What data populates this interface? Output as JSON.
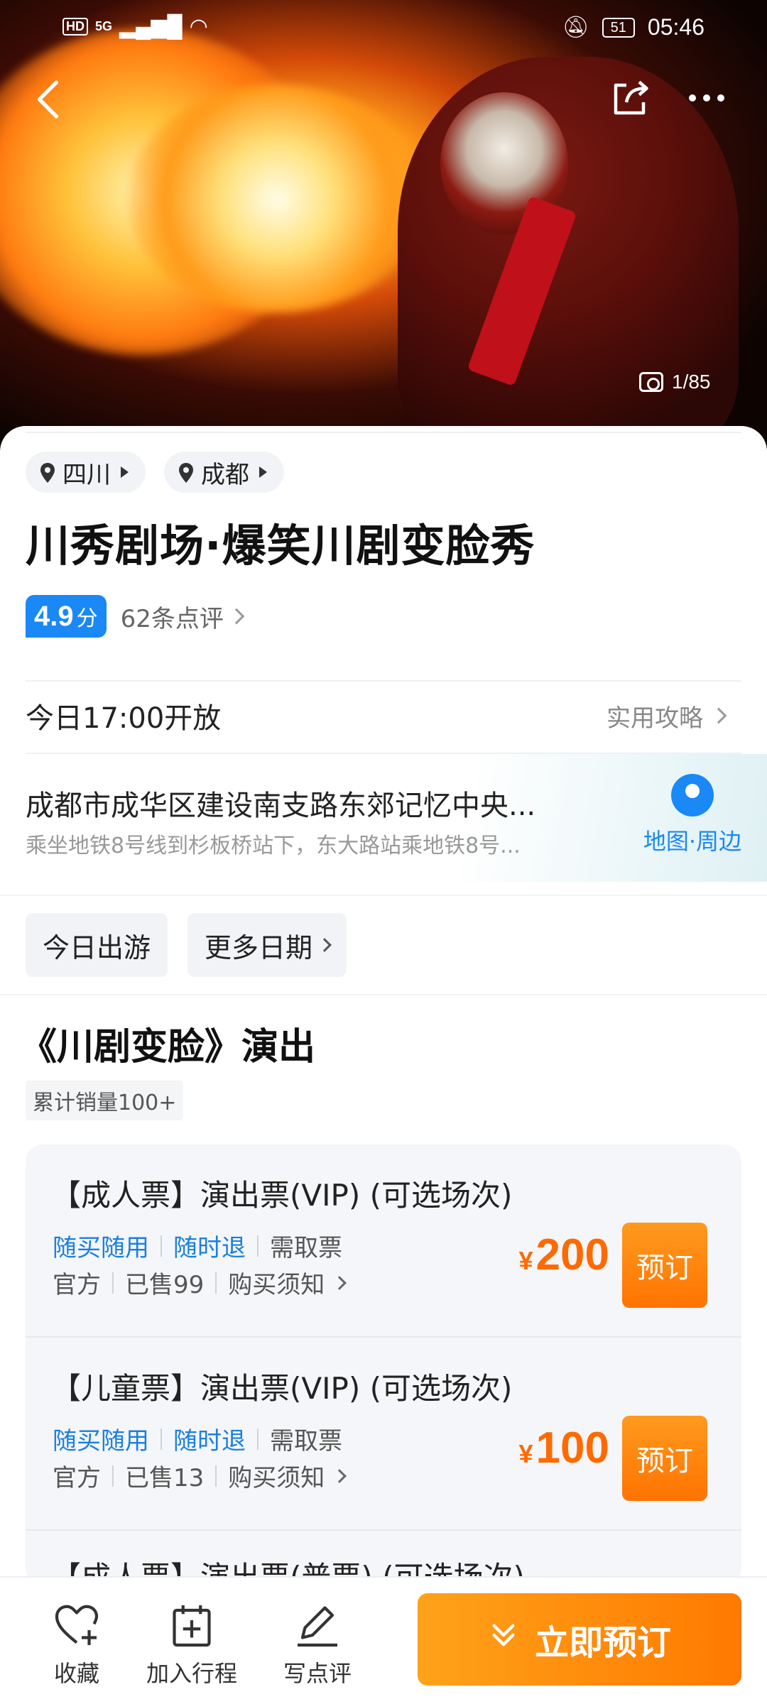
{
  "status": {
    "net_label": "HD",
    "signal": "5G",
    "battery": "51",
    "time": "05:46"
  },
  "hero": {
    "photo_counter": "1/85"
  },
  "location": {
    "province": "四川",
    "city": "成都"
  },
  "attraction": {
    "title": "川秀剧场·爆笑川剧变脸秀",
    "score": "4.9",
    "score_unit": "分",
    "reviews": "62条点评",
    "open_time": "今日17:00开放",
    "guide": "实用攻略",
    "address": "成都市成华区建设南支路东郊记忆中央...",
    "transit": "乘坐地铁8号线到杉板桥站下，东大路站乘地铁8号...",
    "map_label": "地图·周边"
  },
  "dates": {
    "today": "今日出游",
    "more": "更多日期"
  },
  "show": {
    "title": "《川剧变脸》演出",
    "sales": "累计销量100+",
    "tickets": [
      {
        "name": "【成人票】演出票(VIP) (可选场次)",
        "tag1": "随买随用",
        "tag2": "随时退",
        "tag3": "需取票",
        "source": "官方",
        "sold": "已售99",
        "notice": "购买须知",
        "currency": "¥",
        "price": "200",
        "book": "预订"
      },
      {
        "name": "【儿童票】演出票(VIP) (可选场次)",
        "tag1": "随买随用",
        "tag2": "随时退",
        "tag3": "需取票",
        "source": "官方",
        "sold": "已售13",
        "notice": "购买须知",
        "currency": "¥",
        "price": "100",
        "book": "预订"
      },
      {
        "name": "【成人票】演出票(普票) (可选场次)"
      }
    ]
  },
  "bottom_bar": {
    "favorite": "收藏",
    "add_trip": "加入行程",
    "write_review": "写点评",
    "book_now": "立即预订"
  },
  "colors": {
    "accent_blue": "#1a88f5",
    "accent_orange": "#ff7a00"
  }
}
